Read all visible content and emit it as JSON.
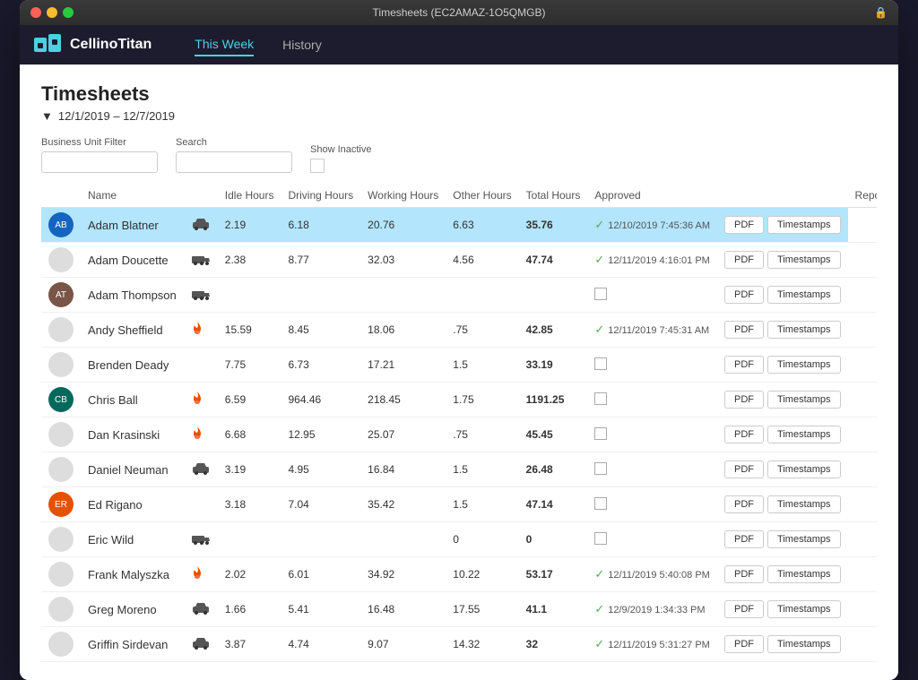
{
  "window": {
    "title": "Timesheets (EC2AMAZ-1O5QMGB)"
  },
  "nav": {
    "logo_text": "CellinoTitan",
    "tab_this_week": "This Week",
    "tab_history": "History"
  },
  "page": {
    "title": "Timesheets",
    "date_range": "12/1/2019 – 12/7/2019",
    "business_unit_filter_label": "Business Unit Filter",
    "search_label": "Search",
    "show_inactive_label": "Show Inactive"
  },
  "table": {
    "columns": [
      "Name",
      "",
      "Idle Hours",
      "Driving Hours",
      "Working Hours",
      "Other Hours",
      "Total Hours",
      "Approved",
      "",
      "Reports"
    ],
    "rows": [
      {
        "name": "Adam Blatner",
        "has_avatar": true,
        "avatar_initials": "AB",
        "avatar_color": "av-blue",
        "has_vehicle": true,
        "vehicle_type": "car",
        "idle": "2.19",
        "driving": "6.18",
        "working": "20.76",
        "other": "6.63",
        "total": "35.76",
        "approved": true,
        "approved_date": "12/10/2019 7:45:36 AM",
        "selected": true
      },
      {
        "name": "Adam Doucette",
        "has_avatar": false,
        "has_vehicle": true,
        "vehicle_type": "truck",
        "idle": "2.38",
        "driving": "8.77",
        "working": "32.03",
        "other": "4.56",
        "total": "47.74",
        "approved": true,
        "approved_date": "12/11/2019 4:16:01 PM",
        "selected": false
      },
      {
        "name": "Adam Thompson",
        "has_avatar": true,
        "avatar_initials": "AT",
        "avatar_color": "av-brown",
        "has_vehicle": true,
        "vehicle_type": "truck",
        "idle": "",
        "driving": "",
        "working": "",
        "other": "",
        "total": "",
        "approved": false,
        "approved_date": "",
        "selected": false
      },
      {
        "name": "Andy Sheffield",
        "has_avatar": false,
        "has_vehicle": true,
        "vehicle_type": "flame",
        "idle": "15.59",
        "driving": "8.45",
        "working": "18.06",
        "other": ".75",
        "total": "42.85",
        "approved": true,
        "approved_date": "12/11/2019 7:45:31 AM",
        "selected": false
      },
      {
        "name": "Brenden Deady",
        "has_avatar": false,
        "has_vehicle": false,
        "idle": "7.75",
        "driving": "6.73",
        "working": "17.21",
        "other": "1.5",
        "total": "33.19",
        "approved": false,
        "approved_date": "",
        "selected": false
      },
      {
        "name": "Chris Ball",
        "has_avatar": true,
        "avatar_initials": "CB",
        "avatar_color": "av-teal",
        "has_vehicle": true,
        "vehicle_type": "flame",
        "idle": "6.59",
        "driving": "964.46",
        "working": "218.45",
        "other": "1.75",
        "total": "1191.25",
        "approved": false,
        "approved_date": "",
        "selected": false
      },
      {
        "name": "Dan Krasinski",
        "has_avatar": false,
        "has_vehicle": true,
        "vehicle_type": "flame",
        "idle": "6.68",
        "driving": "12.95",
        "working": "25.07",
        "other": ".75",
        "total": "45.45",
        "approved": false,
        "approved_date": "",
        "selected": false
      },
      {
        "name": "Daniel Neuman",
        "has_avatar": false,
        "has_vehicle": true,
        "vehicle_type": "car",
        "idle": "3.19",
        "driving": "4.95",
        "working": "16.84",
        "other": "1.5",
        "total": "26.48",
        "approved": false,
        "approved_date": "",
        "selected": false
      },
      {
        "name": "Ed Rigano",
        "has_avatar": true,
        "avatar_initials": "ER",
        "avatar_color": "av-orange",
        "has_vehicle": false,
        "idle": "3.18",
        "driving": "7.04",
        "working": "35.42",
        "other": "1.5",
        "total": "47.14",
        "approved": false,
        "approved_date": "",
        "selected": false
      },
      {
        "name": "Eric Wild",
        "has_avatar": false,
        "has_vehicle": true,
        "vehicle_type": "truck",
        "idle": "",
        "driving": "",
        "working": "",
        "other": "0",
        "total": "0",
        "approved": false,
        "approved_date": "",
        "selected": false
      },
      {
        "name": "Frank Malyszka",
        "has_avatar": false,
        "has_vehicle": true,
        "vehicle_type": "flame",
        "idle": "2.02",
        "driving": "6.01",
        "working": "34.92",
        "other": "10.22",
        "total": "53.17",
        "approved": true,
        "approved_date": "12/11/2019 5:40:08 PM",
        "selected": false
      },
      {
        "name": "Greg Moreno",
        "has_avatar": false,
        "has_vehicle": true,
        "vehicle_type": "car",
        "idle": "1.66",
        "driving": "5.41",
        "working": "16.48",
        "other": "17.55",
        "total": "41.1",
        "approved": true,
        "approved_date": "12/9/2019 1:34:33 PM",
        "selected": false
      },
      {
        "name": "Griffin Sirdevan",
        "has_avatar": false,
        "has_vehicle": true,
        "vehicle_type": "car",
        "idle": "3.87",
        "driving": "4.74",
        "working": "9.07",
        "other": "14.32",
        "total": "32",
        "approved": true,
        "approved_date": "12/11/2019 5:31:27 PM",
        "selected": false
      }
    ],
    "pdf_label": "PDF",
    "timestamps_label": "Timestamps"
  }
}
